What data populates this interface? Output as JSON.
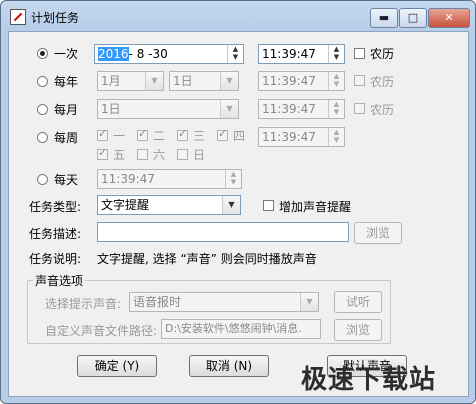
{
  "window": {
    "title": "计划任务"
  },
  "titlebar": {
    "minimize": "▬",
    "maximize": "□",
    "close": "✕"
  },
  "schedule": {
    "once": {
      "label": "一次",
      "date_sel": "2016",
      "date_rest": "- 8 -30",
      "time": "11:39:47",
      "lunar": "农历"
    },
    "yearly": {
      "label": "每年",
      "month": "1月",
      "day": "1日",
      "time": "11:39:47",
      "lunar": "农历"
    },
    "monthly": {
      "label": "每月",
      "day": "1日",
      "time": "11:39:47",
      "lunar": "农历"
    },
    "weekly": {
      "label": "每周",
      "days": [
        "一",
        "二",
        "三",
        "四",
        "五",
        "六",
        "日"
      ],
      "time": "11:39:47"
    },
    "daily": {
      "label": "每天",
      "time": "11:39:47"
    }
  },
  "task": {
    "type_label": "任务类型:",
    "type_value": "文字提醒",
    "sound_label": "增加声音提醒",
    "desc_label": "任务描述:",
    "desc_value": "",
    "browse1": "浏览",
    "info_label": "任务说明:",
    "info_text": "文字提醒, 选择 “声音” 则会同时播放声音"
  },
  "sound": {
    "group_title": "声音选项",
    "select_label": "选择提示声音:",
    "select_value": "语音报时",
    "listen": "试听",
    "custom_label": "自定义声音文件路径:",
    "custom_path": "D:\\安装软件\\悠悠闹钟\\消息.",
    "browse2": "浏览"
  },
  "buttons": {
    "ok": "确定 (Y)",
    "cancel": "取消 (N)",
    "partial": "默认声音"
  },
  "watermark": "极速下载站"
}
